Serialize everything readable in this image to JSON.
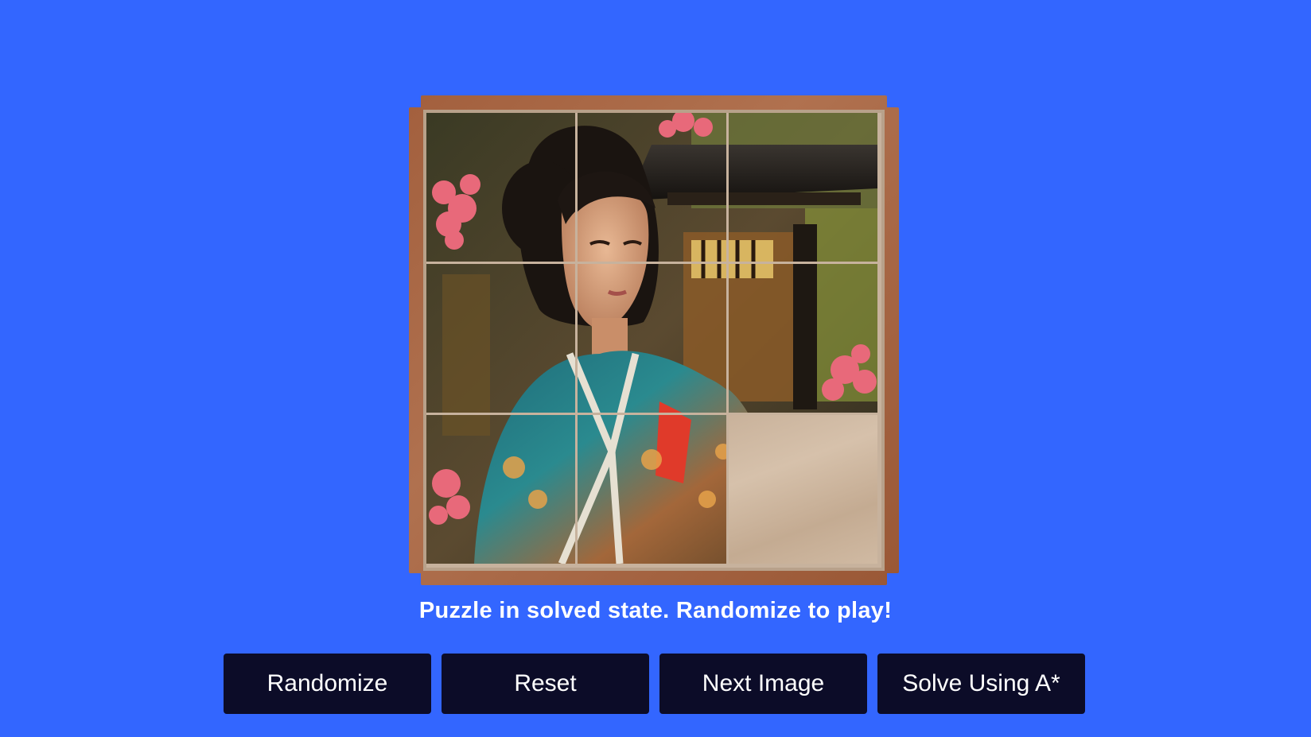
{
  "puzzle": {
    "grid_size": 3,
    "state": [
      1,
      2,
      3,
      4,
      5,
      6,
      7,
      8,
      0
    ],
    "empty_tile": 0,
    "image_description_icon": "kimono-woman-photo-icon"
  },
  "status": {
    "message": "Puzzle in solved state. Randomize to play!"
  },
  "controls": {
    "randomize_label": "Randomize",
    "reset_label": "Reset",
    "next_image_label": "Next Image",
    "solve_label": "Solve Using A*"
  },
  "colors": {
    "background": "#3366ff",
    "button_bg": "#0c0c28",
    "button_text": "#ffffff",
    "frame_wood": "#a3603e",
    "tile_wood": "#c9b29b"
  }
}
